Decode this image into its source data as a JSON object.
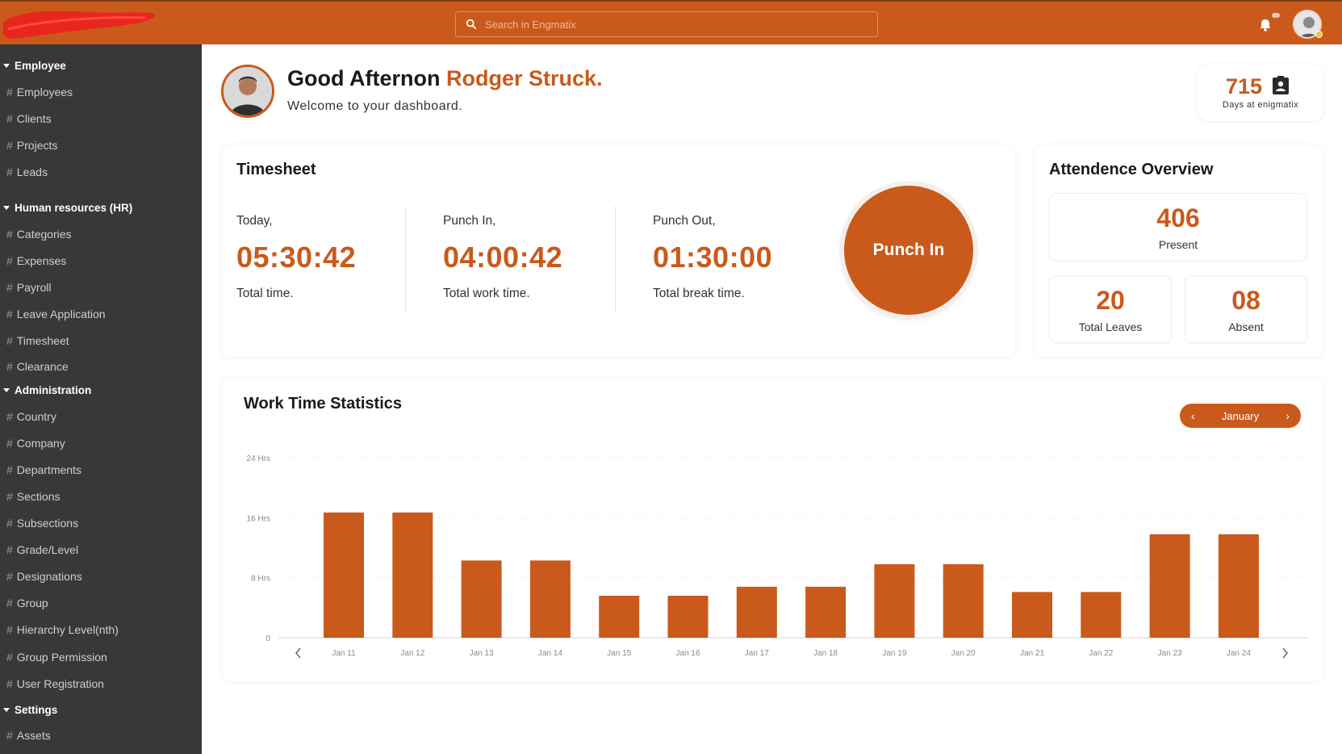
{
  "header": {
    "search_placeholder": "Search in Engmatix",
    "icons": [
      "search-icon",
      "bell-icon",
      "avatar"
    ]
  },
  "sidebar": {
    "sections": [
      {
        "title": "Employee",
        "items": [
          "Employees",
          "Clients",
          "Projects",
          "Leads"
        ]
      },
      {
        "title": "Human resources (HR)",
        "items": [
          "Categories",
          "Expenses",
          "Payroll",
          "Leave Application",
          "Timesheet",
          "Clearance"
        ]
      },
      {
        "title": "Administration",
        "items": [
          "Country",
          "Company",
          "Departments",
          "Sections",
          "Subsections",
          "Grade/Level",
          "Designations",
          "Group",
          "Hierarchy Level(nth)",
          "Group Permission",
          "User Registration"
        ]
      },
      {
        "title": "Settings",
        "items": [
          "Assets"
        ]
      }
    ],
    "hash": "#"
  },
  "greeting": {
    "prefix": "Good Afternon ",
    "name": "Rodger Struck.",
    "subtitle": "Welcome to your dashboard."
  },
  "days": {
    "value": "715",
    "label": "Days at enigmatix"
  },
  "timesheet": {
    "title": "Timesheet",
    "columns": [
      {
        "label": "Today,",
        "value": "05:30:42",
        "desc": "Total time."
      },
      {
        "label": "Punch In,",
        "value": "04:00:42",
        "desc": "Total work time."
      },
      {
        "label": "Punch Out,",
        "value": "01:30:00",
        "desc": "Total break time."
      }
    ],
    "punch_button": "Punch In"
  },
  "attendance": {
    "title": "Attendence Overview",
    "present": {
      "value": "406",
      "label": "Present"
    },
    "leaves": {
      "value": "20",
      "label": "Total Leaves"
    },
    "absent": {
      "value": "08",
      "label": "Absent"
    }
  },
  "stats": {
    "title": "Work Time Statistics",
    "month": "January",
    "accent": "#c95a1c"
  },
  "chart_data": {
    "type": "bar",
    "categories": [
      "Jan 11",
      "Jan 12",
      "Jan 13",
      "Jan 14",
      "Jan 15",
      "Jan 16",
      "Jan 17",
      "Jan 18",
      "Jan 19",
      "Jan 20",
      "Jan 21",
      "Jan 22",
      "Jan 23",
      "Jan 24"
    ],
    "values": [
      16.7,
      16.7,
      10.3,
      10.3,
      5.6,
      5.6,
      6.8,
      6.8,
      9.8,
      9.8,
      6.1,
      6.1,
      13.8,
      13.8
    ],
    "yticks": [
      0,
      8,
      16,
      24
    ],
    "ytick_labels": [
      "0",
      "8 Hrs",
      "16 Hrs",
      "24 Hrs"
    ],
    "ylim": [
      0,
      24
    ],
    "grid": true,
    "color": "#c95a1c"
  }
}
